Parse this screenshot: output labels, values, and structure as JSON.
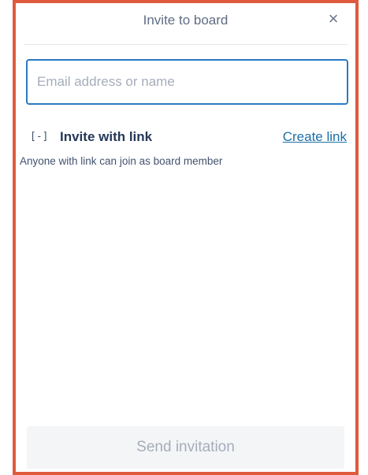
{
  "dialog": {
    "title": "Invite to board",
    "close_symbol": "×"
  },
  "email": {
    "placeholder": "Email address or name",
    "value": ""
  },
  "invite_link": {
    "icon_glyph": "[-]",
    "icon_name": "link-icon",
    "label": "Invite with link",
    "create_link_label": "Create link",
    "hint": "Anyone with link can join as board member"
  },
  "footer": {
    "send_label": "Send invitation",
    "send_enabled": false
  },
  "colors": {
    "frame_border": "#e05a3e",
    "input_border": "#2b79c2",
    "link": "#1d6fa7",
    "disabled_button_bg": "#f4f5f7",
    "disabled_button_text": "#a5adba"
  }
}
